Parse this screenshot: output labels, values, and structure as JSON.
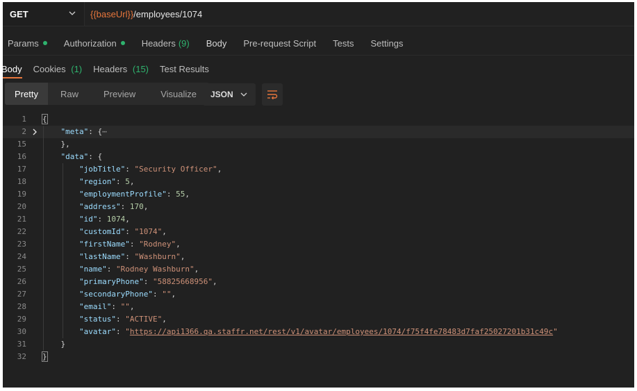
{
  "request": {
    "method": "GET",
    "url_variable": "{{baseUrl}}",
    "url_path": "/employees/1074"
  },
  "request_tabs": [
    {
      "label": "Params",
      "dot": true,
      "count": ""
    },
    {
      "label": "Authorization",
      "dot": true,
      "count": ""
    },
    {
      "label": "Headers",
      "dot": false,
      "count": "(9)"
    },
    {
      "label": "Body",
      "dot": false,
      "count": ""
    },
    {
      "label": "Pre-request Script",
      "dot": false,
      "count": ""
    },
    {
      "label": "Tests",
      "dot": false,
      "count": ""
    },
    {
      "label": "Settings",
      "dot": false,
      "count": ""
    }
  ],
  "response_tabs": {
    "body": "Body",
    "cookies": "Cookies",
    "cookies_count": "(1)",
    "headers": "Headers",
    "headers_count": "(15)",
    "test_results": "Test Results"
  },
  "format_options": [
    "Pretty",
    "Raw",
    "Preview",
    "Visualize"
  ],
  "format_selected": "Pretty",
  "language": "JSON",
  "icons": {
    "method_dropdown": "chevron-down-icon",
    "fold": "chevron-right-icon",
    "wrap": "wrap-lines-icon"
  },
  "colors": {
    "accent": "#e8763c",
    "status_green": "#2fb36e",
    "background": "#212121"
  },
  "code_lines": [
    {
      "n": "1",
      "text": "{"
    },
    {
      "n": "2",
      "text": "    \"meta\": {⋯"
    },
    {
      "n": "15",
      "text": "    },"
    },
    {
      "n": "16",
      "text": "    \"data\": {"
    },
    {
      "n": "17",
      "text": "        \"jobTitle\": \"Security Officer\","
    },
    {
      "n": "18",
      "text": "        \"region\": 5,"
    },
    {
      "n": "19",
      "text": "        \"employmentProfile\": 55,"
    },
    {
      "n": "20",
      "text": "        \"address\": 170,"
    },
    {
      "n": "21",
      "text": "        \"id\": 1074,"
    },
    {
      "n": "22",
      "text": "        \"customId\": \"1074\","
    },
    {
      "n": "23",
      "text": "        \"firstName\": \"Rodney\","
    },
    {
      "n": "24",
      "text": "        \"lastName\": \"Washburn\","
    },
    {
      "n": "25",
      "text": "        \"name\": \"Rodney Washburn\","
    },
    {
      "n": "26",
      "text": "        \"primaryPhone\": \"58825668956\","
    },
    {
      "n": "27",
      "text": "        \"secondaryPhone\": \"\","
    },
    {
      "n": "28",
      "text": "        \"email\": \"\","
    },
    {
      "n": "29",
      "text": "        \"status\": \"ACTIVE\","
    },
    {
      "n": "30",
      "text": "        \"avatar\": \"https://api1366.qa.staffr.net/rest/v1/avatar/employees/1074/f75f4fe78483d7faf25027201b31c49c\""
    },
    {
      "n": "31",
      "text": "    }"
    },
    {
      "n": "32",
      "text": "}"
    }
  ]
}
